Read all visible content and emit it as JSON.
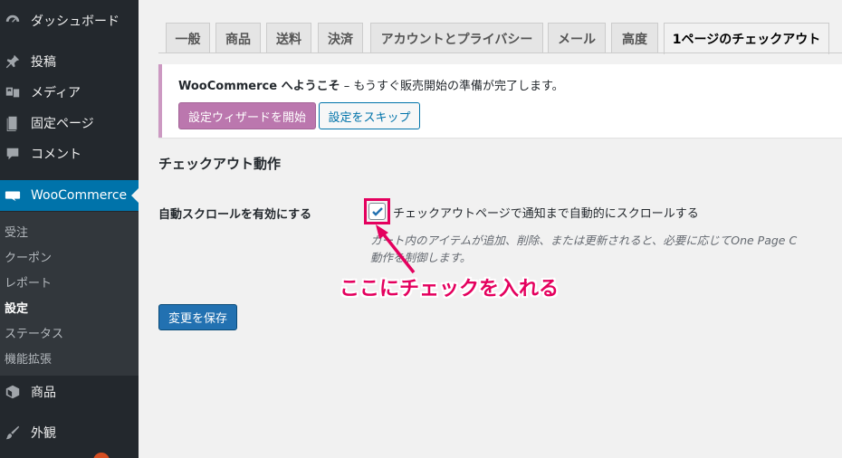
{
  "sidebar": {
    "items": [
      {
        "label": "ダッシュボード",
        "icon": "dashboard-icon"
      },
      {
        "label": "投稿",
        "icon": "pin-icon"
      },
      {
        "label": "メディア",
        "icon": "media-icon"
      },
      {
        "label": "固定ページ",
        "icon": "page-icon"
      },
      {
        "label": "コメント",
        "icon": "comment-icon"
      },
      {
        "label": "WooCommerce",
        "icon": "woo-icon"
      },
      {
        "label": "商品",
        "icon": "product-icon"
      },
      {
        "label": "外観",
        "icon": "paintbrush-icon"
      }
    ],
    "submenu": [
      "受注",
      "クーポン",
      "レポート",
      "設定",
      "ステータス",
      "機能拡張"
    ],
    "current_submenu": "設定",
    "accent_color": "#0073aa"
  },
  "tabs": [
    "一般",
    "商品",
    "送料",
    "決済",
    "アカウントとプライバシー",
    "メール",
    "高度",
    "1ページのチェックアウト"
  ],
  "active_tab": "1ページのチェックアウト",
  "notice": {
    "brand": "WooCommerce へようこそ",
    "message": " – もうすぐ販売開始の準備が完了します。",
    "wizard_button": "設定ウィザードを開始",
    "skip_button": "設定をスキップ",
    "accent_color": "#bb77ae"
  },
  "section": {
    "title": "チェックアウト動作",
    "field_label": "自動スクロールを有効にする",
    "checkbox_label": "チェックアウトページで通知まで自動的にスクロールする",
    "checked": true,
    "description_line1": "カート内のアイテムが追加、削除、または更新されると、必要に応じてOne Page C",
    "description_line2": "動作を制御します。"
  },
  "annotation": {
    "text": "ここにチェックを入れる",
    "color": "#e4005e"
  },
  "save_button": "変更を保存"
}
